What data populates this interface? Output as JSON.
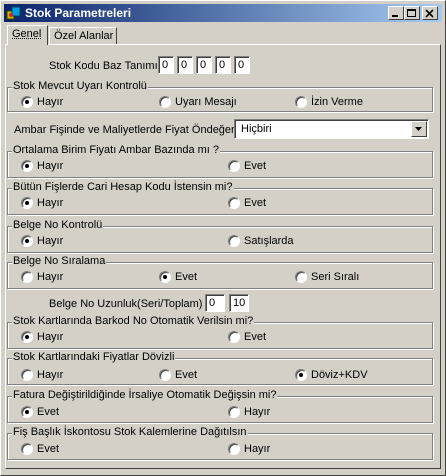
{
  "window": {
    "title": "Stok Parametreleri"
  },
  "tabs": [
    {
      "label": "Genel"
    },
    {
      "label": "Özel Alanlar"
    }
  ],
  "stok_kodu": {
    "label": "Stok Kodu Baz Tanımı",
    "values": [
      "0",
      "0",
      "0",
      "0",
      "0"
    ]
  },
  "mevcut_uyari": {
    "title": "Stok Mevcut Uyarı Kontrolü",
    "options": [
      "Hayır",
      "Uyarı Mesajı",
      "İzin Verme"
    ],
    "selected": "Hayır"
  },
  "ambar": {
    "label": "Ambar Fişinde ve Maliyetlerde Fiyat Öndeğeri",
    "value": "Hiçbiri"
  },
  "ortalama": {
    "title": "Ortalama Birim Fiyatı Ambar Bazında mı ?",
    "options": [
      "Hayır",
      "Evet"
    ],
    "selected": "Hayır"
  },
  "cari_hesap": {
    "title": "Bütün Fişlerde Cari Hesap Kodu İstensin mi?",
    "options": [
      "Hayır",
      "Evet"
    ],
    "selected": "Hayır"
  },
  "belge_kontrol": {
    "title": "Belge No Kontrolü",
    "options": [
      "Hayır",
      "Satışlarda"
    ],
    "selected": "Hayır"
  },
  "belge_siralama": {
    "title": "Belge No Sıralama",
    "options": [
      "Hayır",
      "Evet",
      "Seri Sıralı"
    ],
    "selected": "Evet"
  },
  "belge_uzunluk": {
    "label": "Belge No Uzunluk(Seri/Toplam)",
    "seri": "0",
    "toplam": "10"
  },
  "barkod": {
    "title": "Stok Kartlarında Barkod No Otomatik Verilsin mi?",
    "options": [
      "Hayır",
      "Evet"
    ],
    "selected": "Hayır"
  },
  "doviz": {
    "title": "Stok Kartlarındaki Fiyatlar Dövizli",
    "options": [
      "Hayır",
      "Evet",
      "Döviz+KDV"
    ],
    "selected": "Döviz+KDV"
  },
  "irsaliye": {
    "title": "Fatura Değiştirildiğinde İrsaliye Otomatik Değişsin mi?",
    "options": [
      "Evet",
      "Hayır"
    ],
    "selected": "Evet"
  },
  "iskonto": {
    "title": "Fiş Başlık İskontosu Stok Kalemlerine Dağıtılsın",
    "options": [
      "Evet",
      "Hayır"
    ],
    "selected": ""
  }
}
